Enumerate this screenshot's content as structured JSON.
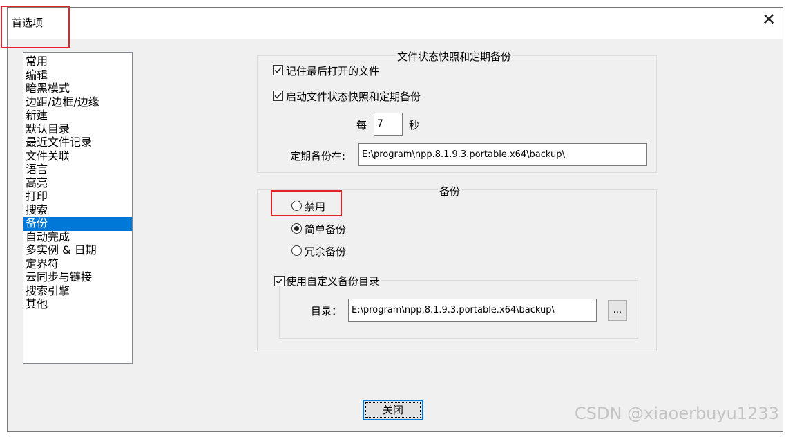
{
  "dialog": {
    "title": "首选项",
    "close_glyph": "✕"
  },
  "categories": [
    {
      "label": "常用",
      "selected": false
    },
    {
      "label": "编辑",
      "selected": false
    },
    {
      "label": "暗黑模式",
      "selected": false
    },
    {
      "label": "边距/边框/边缘",
      "selected": false
    },
    {
      "label": "新建",
      "selected": false
    },
    {
      "label": "默认目录",
      "selected": false
    },
    {
      "label": "最近文件记录",
      "selected": false
    },
    {
      "label": "文件关联",
      "selected": false
    },
    {
      "label": "语言",
      "selected": false
    },
    {
      "label": "高亮",
      "selected": false
    },
    {
      "label": "打印",
      "selected": false
    },
    {
      "label": "搜索",
      "selected": false
    },
    {
      "label": "备份",
      "selected": true
    },
    {
      "label": "自动完成",
      "selected": false
    },
    {
      "label": "多实例 & 日期",
      "selected": false
    },
    {
      "label": "定界符",
      "selected": false
    },
    {
      "label": "云同步与链接",
      "selected": false
    },
    {
      "label": "搜索引擎",
      "selected": false
    },
    {
      "label": "其他",
      "selected": false
    }
  ],
  "snapshot": {
    "group_title": "文件状态快照和定期备份",
    "remember_last": {
      "label": "记住最后打开的文件",
      "checked": true
    },
    "enable_snapshot": {
      "label": "启动文件状态快照和定期备份",
      "checked": true
    },
    "every_label": "每",
    "interval": "7",
    "unit_label": "秒",
    "path_label": "定期备份在:",
    "path_value": "E:\\program\\npp.8.1.9.3.portable.x64\\backup\\"
  },
  "backup": {
    "group_title": "备份",
    "options": [
      {
        "label": "禁用",
        "selected": false
      },
      {
        "label": "简单备份",
        "selected": true
      },
      {
        "label": "冗余备份",
        "selected": false
      }
    ],
    "custom_dir": {
      "label": "使用自定义备份目录",
      "checked": true
    },
    "dir_label": "目录：",
    "dir_value": "E:\\program\\npp.8.1.9.3.portable.x64\\backup\\",
    "browse_label": "..."
  },
  "footer": {
    "close_label": "关闭"
  },
  "watermark": "CSDN @xiaoerbuyu1233",
  "colors": {
    "selection": "#0078d7",
    "annotation_red": "#e0242a"
  }
}
